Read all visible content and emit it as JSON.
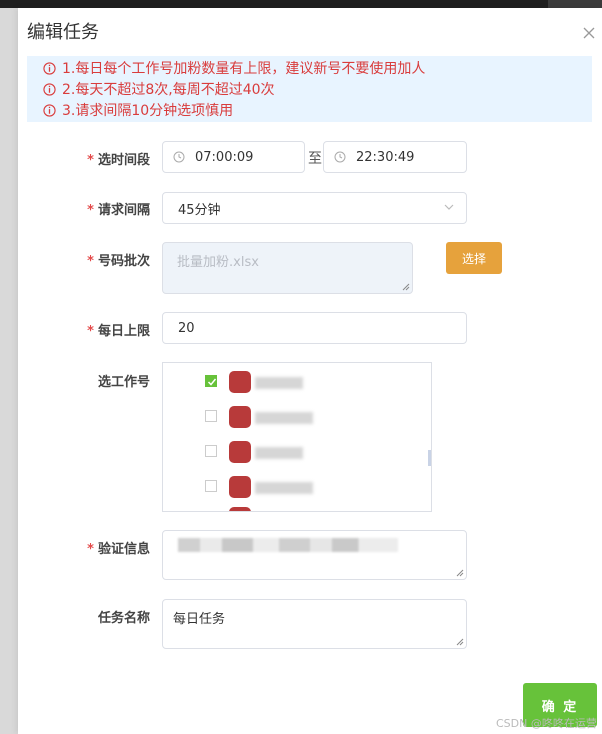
{
  "dialog": {
    "title": "编辑任务",
    "alerts": [
      "1.每日每个工作号加粉数量有上限，建议新号不要使用加人",
      "2.每天不超过8次,每周不超过40次",
      "3.请求间隔10分钟选项慎用"
    ]
  },
  "form": {
    "time_range": {
      "label": "选时间段",
      "start": "07:00:09",
      "separator": "至",
      "end": "22:30:49"
    },
    "interval": {
      "label": "请求间隔",
      "value": "45分钟"
    },
    "batch": {
      "label": "号码批次",
      "placeholder": "批量加粉.xlsx",
      "select_label": "选择"
    },
    "daily_limit": {
      "label": "每日上限",
      "value": "20"
    },
    "workers": {
      "label": "选工作号",
      "items": [
        {
          "checked": true
        },
        {
          "checked": false
        },
        {
          "checked": false
        },
        {
          "checked": false
        }
      ]
    },
    "verify": {
      "label": "验证信息"
    },
    "task_name": {
      "label": "任务名称",
      "value": "每日任务"
    }
  },
  "footer": {
    "confirm_label": "确 定",
    "watermark": "CSDN @咚咚在运营"
  },
  "colors": {
    "alert_bg": "#e8f4ff",
    "alert_text": "#d93c3c",
    "primary_green": "#67c23a",
    "warning_orange": "#e6a23c"
  }
}
